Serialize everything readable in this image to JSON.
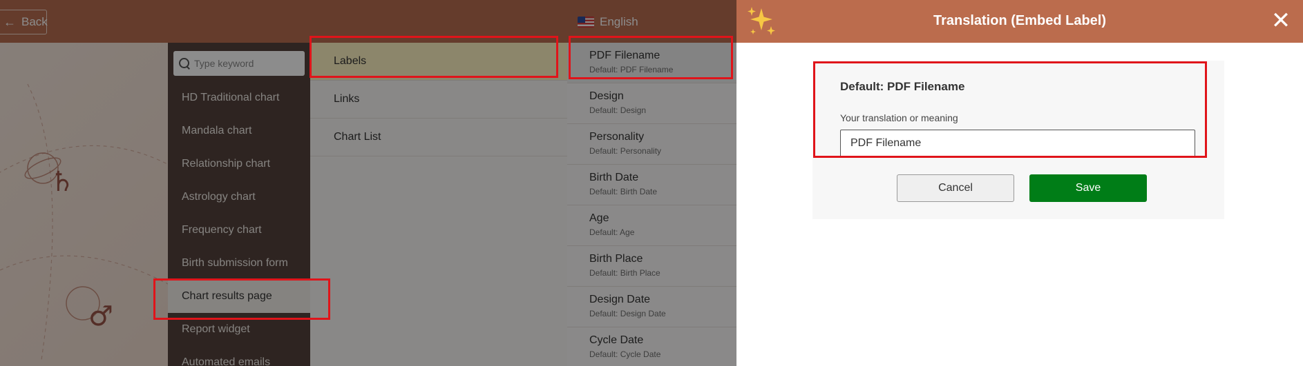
{
  "topbar": {
    "back_label": "Back",
    "back_icon": "arrow-left-icon",
    "language": "English",
    "language_icon": "us-flag-icon"
  },
  "sidebar": {
    "search_placeholder": "Type keyword",
    "items": [
      {
        "label": "HD Traditional chart"
      },
      {
        "label": "Mandala chart"
      },
      {
        "label": "Relationship chart"
      },
      {
        "label": "Astrology chart"
      },
      {
        "label": "Frequency chart"
      },
      {
        "label": "Birth submission form"
      },
      {
        "label": "Chart results page"
      },
      {
        "label": "Report widget"
      },
      {
        "label": "Automated emails"
      }
    ],
    "active_index": 6
  },
  "subnav": {
    "items": [
      {
        "label": "Labels"
      },
      {
        "label": "Links"
      },
      {
        "label": "Chart List"
      }
    ],
    "active_index": 0
  },
  "labels": {
    "items": [
      {
        "name": "PDF Filename",
        "default": "Default: PDF Filename"
      },
      {
        "name": "Design",
        "default": "Default: Design"
      },
      {
        "name": "Personality",
        "default": "Default: Personality"
      },
      {
        "name": "Birth Date",
        "default": "Default: Birth Date"
      },
      {
        "name": "Age",
        "default": "Default: Age"
      },
      {
        "name": "Birth Place",
        "default": "Default: Birth Place"
      },
      {
        "name": "Design Date",
        "default": "Default: Design Date"
      },
      {
        "name": "Cycle Date",
        "default": "Default: Cycle Date"
      }
    ],
    "active_index": 0
  },
  "panel": {
    "title": "Translation (Embed Label)",
    "icon": "sparkles-icon",
    "close_icon": "close-icon",
    "default_text": "Default: PDF Filename",
    "field_label": "Your translation or meaning",
    "field_value": "PDF Filename",
    "cancel_label": "Cancel",
    "save_label": "Save"
  },
  "colors": {
    "header": "#bb6c4d",
    "sidebar_bg": "#54433d",
    "save_button": "#007d17",
    "highlight": "#e0141a"
  }
}
